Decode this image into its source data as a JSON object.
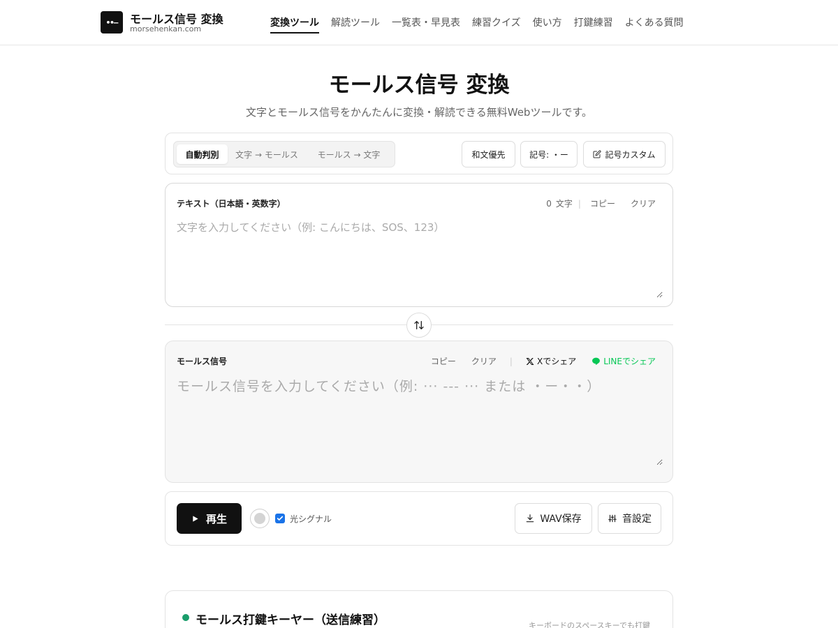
{
  "header": {
    "logo_glyph": "••–",
    "brand_title": "モールス信号 変換",
    "brand_domain": "morsehenkan.com",
    "nav": [
      {
        "label": "変換ツール",
        "active": true
      },
      {
        "label": "解読ツール",
        "active": false
      },
      {
        "label": "一覧表・早見表",
        "active": false
      },
      {
        "label": "練習クイズ",
        "active": false
      },
      {
        "label": "使い方",
        "active": false
      },
      {
        "label": "打鍵練習",
        "active": false
      },
      {
        "label": "よくある質問",
        "active": false
      }
    ]
  },
  "hero": {
    "title": "モールス信号 変換",
    "subtitle": "文字とモールス信号をかんたんに変換・解読できる無料Webツールです。"
  },
  "mode_bar": {
    "modes": [
      {
        "label": "自動判別",
        "active": true
      },
      {
        "label": "文字 → モールス",
        "active": false
      },
      {
        "label": "モールス → 文字",
        "active": false
      }
    ],
    "wabun_label": "和文優先",
    "symbol_label": "記号: ・ー",
    "custom_label": "記号カスタム",
    "custom_icon": "edit-icon"
  },
  "text_panel": {
    "label": "テキスト（日本語・英数字）",
    "count_value": "0",
    "count_unit": "文字",
    "copy_label": "コピー",
    "clear_label": "クリア",
    "placeholder": "文字を入力してください（例: こんにちは、SOS、123）"
  },
  "swap": {
    "icon": "swap-vertical-icon"
  },
  "morse_panel": {
    "label": "モールス信号",
    "copy_label": "コピー",
    "clear_label": "クリア",
    "x_share_label": "Xでシェア",
    "line_share_label": "LINEでシェア",
    "placeholder": "モールス信号を入力してください（例: ··· --- ··· または ・ー・・）"
  },
  "playback": {
    "play_label": "再生",
    "light_signal_label": "光シグナル",
    "light_signal_checked": true,
    "wav_label": "WAV保存",
    "sound_settings_label": "音設定"
  },
  "keyer": {
    "title": "モールス打鍵キーヤー（送信練習）",
    "note": "キーボードのスペースキーでも打鍵"
  },
  "colors": {
    "primary": "#111111",
    "line_green": "#06c755",
    "keyer_dot": "#1a9d6b",
    "checkbox_blue": "#1a73e8"
  }
}
